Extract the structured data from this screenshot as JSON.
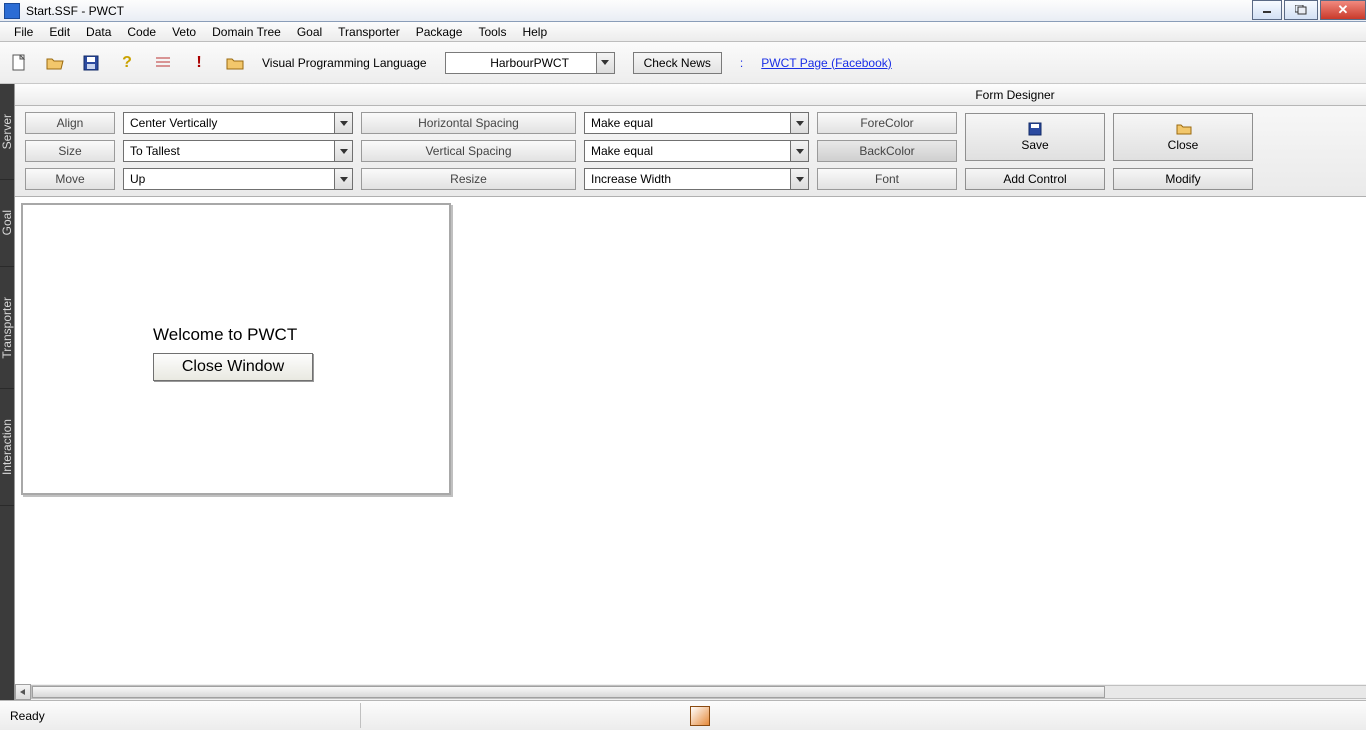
{
  "window": {
    "title": "Start.SSF  - PWCT"
  },
  "menu": [
    "File",
    "Edit",
    "Data",
    "Code",
    "Veto",
    "Domain Tree",
    "Goal",
    "Transporter",
    "Package",
    "Tools",
    "Help"
  ],
  "toolbar": {
    "lang_label": "Visual Programming Language",
    "lang_value": "HarbourPWCT",
    "check_news": "Check News",
    "fb_link": "PWCT Page (Facebook)"
  },
  "sidebar": [
    "Server",
    "Goal",
    "Transporter",
    "Interaction"
  ],
  "form_designer": {
    "title": "Form Designer",
    "row1": {
      "btn": "Align",
      "select": "Center Vertically",
      "btn2": "Horizontal Spacing",
      "select2": "Make equal",
      "btn3": "ForeColor"
    },
    "row2": {
      "btn": "Size",
      "select": "To Tallest",
      "btn2": "Vertical Spacing",
      "select2": "Make equal",
      "btn3": "BackColor"
    },
    "row3": {
      "btn": "Move",
      "select": "Up",
      "btn2": "Resize",
      "select2": "Increase Width",
      "btn3": "Font",
      "btn4": "Add Control",
      "btn5": "Modify"
    },
    "save": "Save",
    "close": "Close"
  },
  "canvas": {
    "welcome": "Welcome to PWCT",
    "close_window": "Close Window"
  },
  "status": {
    "text": "Ready"
  }
}
